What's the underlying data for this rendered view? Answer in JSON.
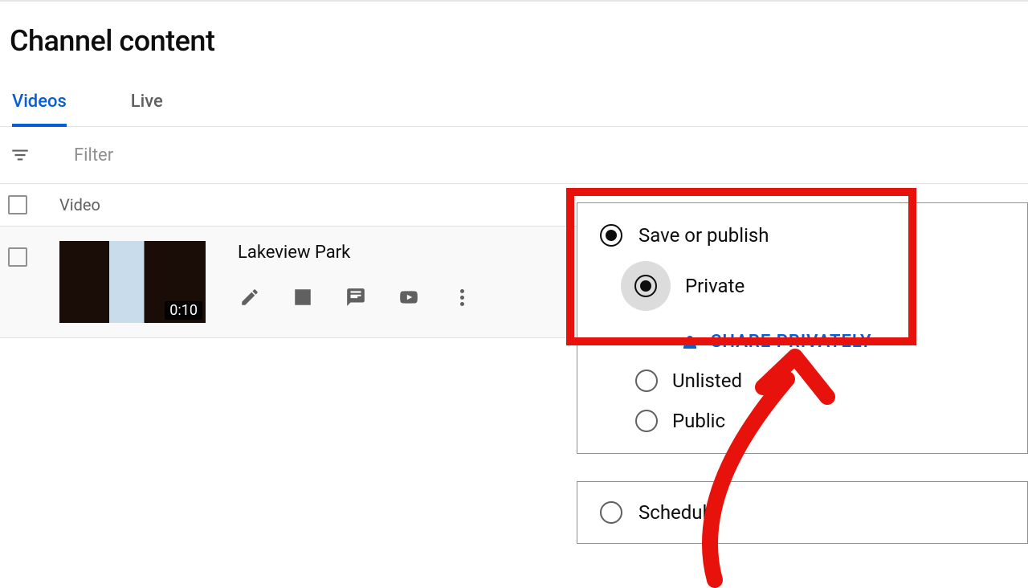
{
  "page": {
    "title": "Channel content"
  },
  "tabs": [
    {
      "label": "Videos",
      "active": true
    },
    {
      "label": "Live",
      "active": false
    }
  ],
  "filter": {
    "placeholder": "Filter"
  },
  "columns": {
    "video": "Video"
  },
  "video": {
    "title": "Lakeview Park",
    "duration": "0:10"
  },
  "visibility": {
    "save_or_publish": "Save or publish",
    "private": "Private",
    "share_privately": "SHARE PRIVATELY",
    "unlisted": "Unlisted",
    "public": "Public",
    "schedule": "Schedule"
  },
  "colors": {
    "accent": "#065fd4",
    "annotation": "#e8120c"
  }
}
